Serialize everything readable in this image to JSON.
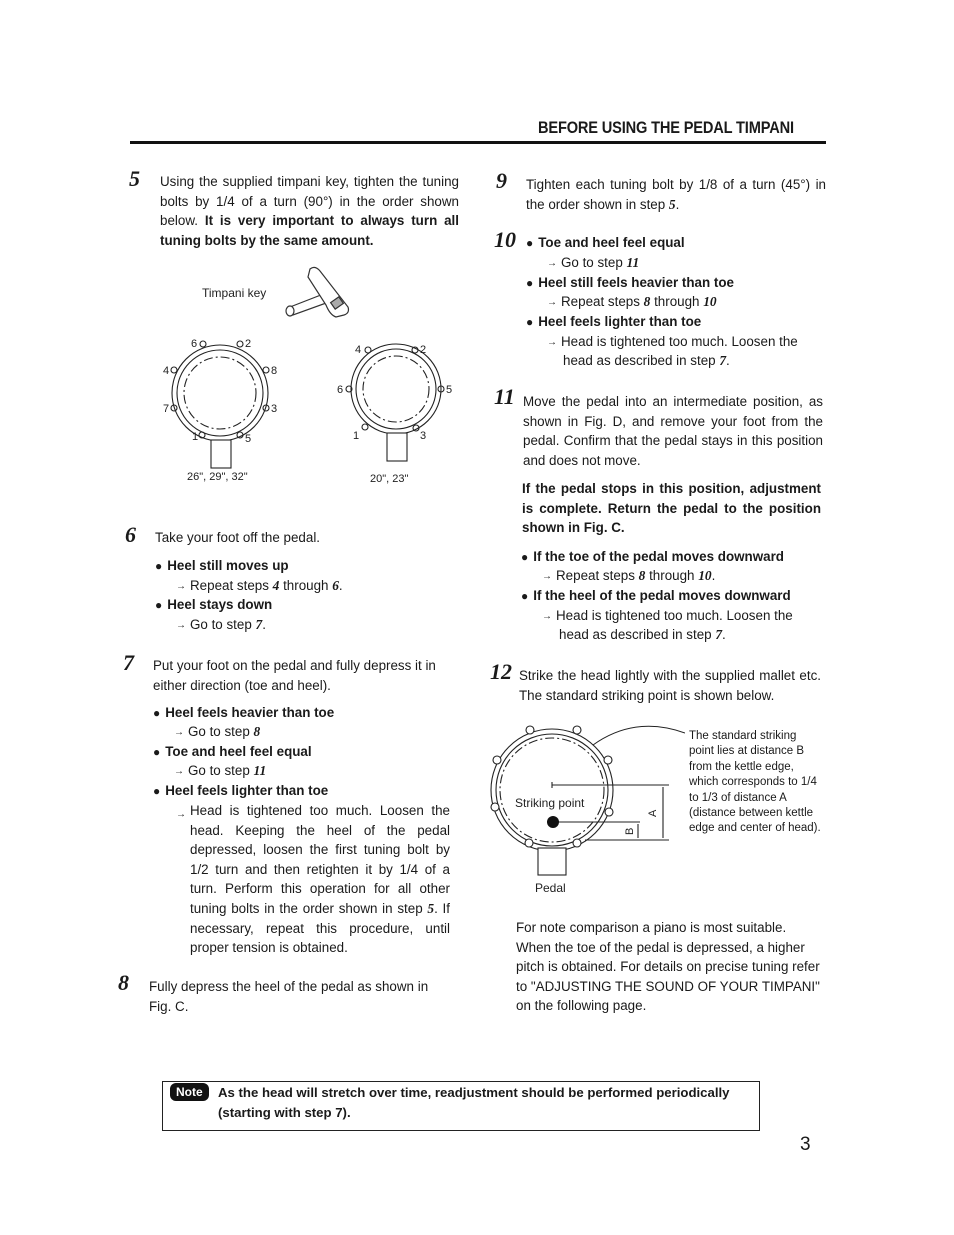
{
  "header": {
    "title": "BEFORE USING THE PEDAL TIMPANI"
  },
  "steps": {
    "s5": {
      "num": "5",
      "text_normal": "Using the supplied timpani key, tighten the tuning bolts by 1/4 of a turn (90°) in the order shown below. ",
      "text_bold": "It is very important to always turn all tuning bolts by the same amount."
    },
    "s6": {
      "num": "6",
      "text": "Take your foot off the pedal.",
      "bullets": [
        {
          "label": "Heel still moves up",
          "action_pre": "Repeat steps ",
          "action_ref1": "4",
          "action_mid": " through ",
          "action_ref2": "6",
          "action_post": "."
        },
        {
          "label": "Heel stays down",
          "action_pre": "Go to step ",
          "action_ref1": "7",
          "action_post": "."
        }
      ]
    },
    "s7": {
      "num": "7",
      "text": "Put your foot on the pedal and fully depress it in either direction (toe and heel).",
      "bullets": [
        {
          "label": "Heel feels heavier than toe",
          "action_pre": "Go to step ",
          "action_ref1": "8"
        },
        {
          "label": "Toe and heel feel equal",
          "action_pre": "Go to step ",
          "action_ref1": "11"
        },
        {
          "label": "Heel feels lighter than toe",
          "action_text_a": "Head is tightened too much. Loosen the head. Keeping the heel of the pedal depressed, loosen the first tuning bolt by 1/2 turn and then retighten it by 1/4 of a turn. Perform this operation for all other tuning bolts in the order shown in step ",
          "action_ref": "5",
          "action_text_b": ". If necessary, repeat this procedure, until proper tension is obtained."
        }
      ]
    },
    "s8": {
      "num": "8",
      "text": "Fully depress the heel of the pedal as shown in Fig. C."
    },
    "s9": {
      "num": "9",
      "text_pre": "Tighten each tuning bolt by 1/8 of a turn (45°) in the order shown in step ",
      "ref": "5",
      "text_post": "."
    },
    "s10": {
      "num": "10",
      "bullets": [
        {
          "label": "Toe and heel feel equal",
          "action_pre": "Go to step ",
          "action_ref1": "11"
        },
        {
          "label": "Heel still feels heavier than toe",
          "action_pre": "Repeat steps ",
          "action_ref1": "8",
          "action_mid": " through ",
          "action_ref2": "10"
        },
        {
          "label": "Heel feels lighter than toe",
          "action_line1": "Head is tightened too much. Loosen the",
          "action_line2_pre": "head as described in step ",
          "action_ref": "7",
          "action_post": "."
        }
      ]
    },
    "s11": {
      "num": "11",
      "text": "Move the pedal into an intermediate position, as shown in Fig. D, and remove your foot from the pedal. Confirm that the pedal stays in this position and does not move.",
      "text_bold": "If the pedal stops in this position, adjustment is complete. Return the pedal to the position shown in Fig. C.",
      "bullets": [
        {
          "label": "If the toe of the pedal moves downward",
          "action_pre": "Repeat steps ",
          "action_ref1": "8",
          "action_mid": " through ",
          "action_ref2": "10",
          "action_post": "."
        },
        {
          "label": "If the heel of the pedal moves downward",
          "action_line1": "Head is tightened too much. Loosen the",
          "action_line2_pre": "head as described in step ",
          "action_ref": "7",
          "action_post": "."
        }
      ]
    },
    "s12": {
      "num": "12",
      "text": "Strike the head lightly with the supplied mallet etc. The standard striking point is shown below.",
      "after": "For note comparison a piano is most suitable. When the toe of the pedal is depressed, a higher pitch is obtained. For details on precise tuning refer to \"ADJUSTING THE SOUND OF YOUR TIMPANI\" on the following page."
    }
  },
  "figure_bolts": {
    "key_label": "Timpani key",
    "drum_large": {
      "caption": "26\", 29\", 32\"",
      "bolts": [
        "6",
        "2",
        "4",
        "8",
        "7",
        "3",
        "1",
        "5"
      ]
    },
    "drum_small": {
      "caption": "20\", 23\"",
      "bolts": [
        "4",
        "2",
        "6",
        "5",
        "1",
        "3"
      ]
    }
  },
  "figure_strike": {
    "striking_point_label": "Striking point",
    "pedal_label": "Pedal",
    "dim_a": "A",
    "dim_b": "B",
    "callout": "The standard striking point lies at distance B from the kettle edge, which corresponds to 1/4 to 1/3 of distance A (distance between kettle edge and center of head)."
  },
  "note": {
    "badge": "Note",
    "text": "As the head will stretch over time, readjustment should be performed periodically (starting with step 7)."
  },
  "page_number": "3"
}
